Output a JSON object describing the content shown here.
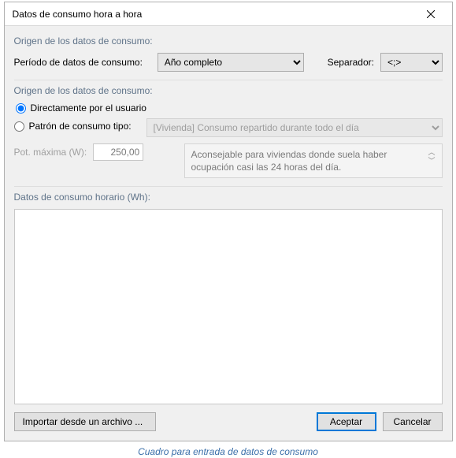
{
  "dialog": {
    "title": "Datos de consumo hora a hora"
  },
  "group_origin1": {
    "heading": "Origen de los datos de consumo:",
    "period_label": "Período de datos de consumo:",
    "period_value": "Año completo",
    "separator_label": "Separador:",
    "separator_value": "<;>"
  },
  "group_origin2": {
    "heading": "Origen de los datos de consumo:",
    "radio_user_label": "Directamente por el usuario",
    "radio_pattern_label": "Patrón de consumo tipo:",
    "pattern_value": "[Vivienda] Consumo repartido durante todo el día",
    "description": "Aconsejable para viviendas donde suela haber ocupación casi las 24 horas del día.",
    "pot_label": "Pot. máxima (W):",
    "pot_value": "250,00"
  },
  "group_hourly": {
    "heading": "Datos de consumo horario (Wh):"
  },
  "buttons": {
    "import": "Importar desde un archivo ...",
    "accept": "Aceptar",
    "cancel": "Cancelar"
  },
  "caption": "Cuadro para entrada de datos de consumo"
}
